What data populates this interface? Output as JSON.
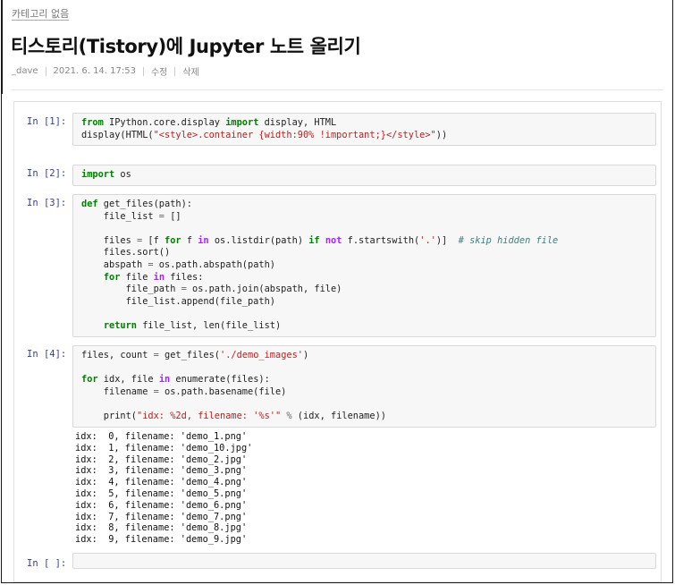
{
  "header": {
    "category": "카테고리 없음",
    "title": "티스토리(Tistory)에 Jupyter 노트 올리기",
    "author": "_dave",
    "date": "2021. 6. 14. 17:53",
    "edit_label": "수정",
    "delete_label": "삭제"
  },
  "cells": [
    {
      "prompt": "In [1]:",
      "lines": [
        [
          [
            "kw",
            "from"
          ],
          [
            "",
            " IPython.core.display "
          ],
          [
            "kw",
            "import"
          ],
          [
            "",
            " display, HTML"
          ]
        ],
        [
          [
            "",
            "display(HTML("
          ],
          [
            "str",
            "\"<style>.container {width:90% !important;}</style>\""
          ],
          [
            "",
            "))"
          ]
        ]
      ]
    },
    {
      "prompt": "In [2]:",
      "lines": [
        [
          [
            "kw",
            "import"
          ],
          [
            "",
            " os"
          ]
        ]
      ]
    },
    {
      "prompt": "In [3]:",
      "lines": [
        [
          [
            "kw",
            "def"
          ],
          [
            "",
            " get_files(path):"
          ]
        ],
        [
          [
            "",
            "    file_list "
          ],
          [
            "op",
            "="
          ],
          [
            "",
            " []"
          ]
        ],
        [
          [
            "",
            ""
          ]
        ],
        [
          [
            "",
            "    files "
          ],
          [
            "op",
            "="
          ],
          [
            "",
            " [f "
          ],
          [
            "kw",
            "for"
          ],
          [
            "",
            " f "
          ],
          [
            "kw2",
            "in"
          ],
          [
            "",
            " os.listdir(path) "
          ],
          [
            "kw",
            "if"
          ],
          [
            "",
            " "
          ],
          [
            "kw2",
            "not"
          ],
          [
            "",
            " f.startswith("
          ],
          [
            "str",
            "'.'"
          ],
          [
            "",
            ")]  "
          ],
          [
            "cm",
            "# skip hidden file"
          ]
        ],
        [
          [
            "",
            "    files.sort()"
          ]
        ],
        [
          [
            "",
            "    abspath "
          ],
          [
            "op",
            "="
          ],
          [
            "",
            " os.path.abspath(path)"
          ]
        ],
        [
          [
            "",
            "    "
          ],
          [
            "kw",
            "for"
          ],
          [
            "",
            " file "
          ],
          [
            "kw2",
            "in"
          ],
          [
            "",
            " files:"
          ]
        ],
        [
          [
            "",
            "        file_path "
          ],
          [
            "op",
            "="
          ],
          [
            "",
            " os.path.join(abspath, file)"
          ]
        ],
        [
          [
            "",
            "        file_list.append(file_path)"
          ]
        ],
        [
          [
            "",
            ""
          ]
        ],
        [
          [
            "",
            "    "
          ],
          [
            "kw",
            "return"
          ],
          [
            "",
            " file_list, len(file_list)"
          ]
        ]
      ]
    },
    {
      "prompt": "In [4]:",
      "lines": [
        [
          [
            "",
            "files, count "
          ],
          [
            "op",
            "="
          ],
          [
            "",
            " get_files("
          ],
          [
            "str",
            "'./demo_images'"
          ],
          [
            "",
            ")"
          ]
        ],
        [
          [
            "",
            ""
          ]
        ],
        [
          [
            "kw",
            "for"
          ],
          [
            "",
            " idx, file "
          ],
          [
            "kw2",
            "in"
          ],
          [
            "",
            " enumerate(files):"
          ]
        ],
        [
          [
            "",
            "    filename "
          ],
          [
            "op",
            "="
          ],
          [
            "",
            " os.path.basename(file)"
          ]
        ],
        [
          [
            "",
            ""
          ]
        ],
        [
          [
            "",
            "    print("
          ],
          [
            "str",
            "\"idx: %2d, filename: '%s'\""
          ],
          [
            "",
            " "
          ],
          [
            "op",
            "%"
          ],
          [
            "",
            " (idx, filename))"
          ]
        ]
      ]
    }
  ],
  "output_lines": [
    "idx:  0, filename: 'demo_1.png'",
    "idx:  1, filename: 'demo_10.jpg'",
    "idx:  2, filename: 'demo_2.jpg'",
    "idx:  3, filename: 'demo_3.png'",
    "idx:  4, filename: 'demo_4.png'",
    "idx:  5, filename: 'demo_5.png'",
    "idx:  6, filename: 'demo_6.png'",
    "idx:  7, filename: 'demo_7.png'",
    "idx:  8, filename: 'demo_8.jpg'",
    "idx:  9, filename: 'demo_9.jpg'"
  ],
  "empty_cell_prompt": "In [ ]:"
}
